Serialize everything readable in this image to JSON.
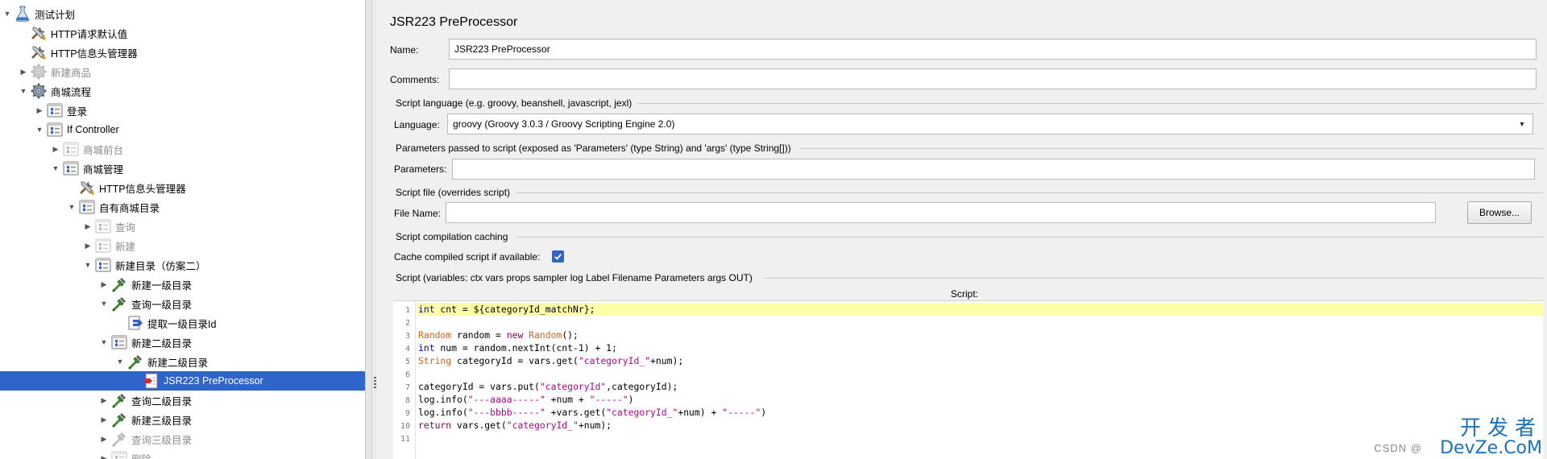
{
  "tree": {
    "items": [
      {
        "label": "测试计划",
        "icon": "flask-icon",
        "level": 0,
        "expander": "down",
        "disabled": false,
        "selected": false
      },
      {
        "label": "HTTP请求默认值",
        "icon": "tools-icon",
        "level": 1,
        "expander": "none",
        "disabled": false,
        "selected": false
      },
      {
        "label": "HTTP信息头管理器",
        "icon": "tools-icon",
        "level": 1,
        "expander": "none",
        "disabled": false,
        "selected": false
      },
      {
        "label": "新建商品",
        "icon": "gear-icon",
        "level": 1,
        "expander": "right",
        "disabled": true,
        "selected": false
      },
      {
        "label": "商城流程",
        "icon": "gear-icon",
        "level": 1,
        "expander": "down",
        "disabled": false,
        "selected": false
      },
      {
        "label": "登录",
        "icon": "controller-icon",
        "level": 2,
        "expander": "right",
        "disabled": false,
        "selected": false
      },
      {
        "label": "If Controller",
        "icon": "controller-icon",
        "level": 2,
        "expander": "down",
        "disabled": false,
        "selected": false
      },
      {
        "label": "商城前台",
        "icon": "controller-icon",
        "level": 3,
        "expander": "right",
        "disabled": true,
        "selected": false
      },
      {
        "label": "商城管理",
        "icon": "controller-icon",
        "level": 3,
        "expander": "down",
        "disabled": false,
        "selected": false
      },
      {
        "label": "HTTP信息头管理器",
        "icon": "tools-icon",
        "level": 4,
        "expander": "none",
        "disabled": false,
        "selected": false
      },
      {
        "label": "自有商城目录",
        "icon": "controller-icon",
        "level": 4,
        "expander": "down",
        "disabled": false,
        "selected": false
      },
      {
        "label": "查询",
        "icon": "controller-icon",
        "level": 5,
        "expander": "right",
        "disabled": true,
        "selected": false
      },
      {
        "label": "新建",
        "icon": "controller-icon",
        "level": 5,
        "expander": "right",
        "disabled": true,
        "selected": false
      },
      {
        "label": "新建目录（仿案二）",
        "icon": "controller-icon",
        "level": 5,
        "expander": "down",
        "disabled": false,
        "selected": false
      },
      {
        "label": "新建一级目录",
        "icon": "sampler-icon",
        "level": 6,
        "expander": "right",
        "disabled": false,
        "selected": false
      },
      {
        "label": "查询一级目录",
        "icon": "sampler-icon",
        "level": 6,
        "expander": "down",
        "disabled": false,
        "selected": false
      },
      {
        "label": "提取一级目录Id",
        "icon": "extractor-icon",
        "level": 7,
        "expander": "none",
        "disabled": false,
        "selected": false
      },
      {
        "label": "新建二级目录",
        "icon": "controller-icon",
        "level": 6,
        "expander": "down",
        "disabled": false,
        "selected": false
      },
      {
        "label": "新建二级目录",
        "icon": "sampler-icon",
        "level": 7,
        "expander": "down",
        "disabled": false,
        "selected": false
      },
      {
        "label": "JSR223 PreProcessor",
        "icon": "script-icon",
        "level": 8,
        "expander": "none",
        "disabled": false,
        "selected": true
      },
      {
        "label": "查询二级目录",
        "icon": "sampler-icon",
        "level": 6,
        "expander": "right",
        "disabled": false,
        "selected": false
      },
      {
        "label": "新建三级目录",
        "icon": "sampler-icon",
        "level": 6,
        "expander": "right",
        "disabled": false,
        "selected": false
      },
      {
        "label": "查询三级目录",
        "icon": "sampler-icon",
        "level": 6,
        "expander": "right",
        "disabled": true,
        "selected": false
      },
      {
        "label": "删除",
        "icon": "controller-icon",
        "level": 6,
        "expander": "right",
        "disabled": true,
        "selected": false
      }
    ]
  },
  "editor": {
    "title": "JSR223 PreProcessor",
    "name_label": "Name:",
    "name_value": "JSR223 PreProcessor",
    "comments_label": "Comments:",
    "comments_value": "",
    "script_language_section": "Script language (e.g. groovy, beanshell, javascript, jexl)",
    "language_label": "Language:",
    "language_value": "groovy     (Groovy 3.0.3 / Groovy Scripting Engine 2.0)",
    "parameters_section": "Parameters passed to script (exposed as 'Parameters' (type String) and 'args' (type String[]))",
    "parameters_label": "Parameters:",
    "parameters_value": "",
    "script_file_section": "Script file (overrides script)",
    "file_name_label": "File Name:",
    "file_name_value": "",
    "browse_label": "Browse...",
    "caching_section": "Script compilation caching",
    "cache_label": "Cache compiled script if available:",
    "cache_checked": true,
    "script_section": "Script (variables: ctx vars props sampler log Label Filename Parameters args OUT)",
    "script_header": "Script:",
    "code_lines": [
      "int cnt = ${categoryId_matchNr};",
      "",
      "Random random = new Random();",
      "int num = random.nextInt(cnt-1) + 1;",
      "String categoryId = vars.get(\"categoryId_\"+num);",
      "",
      "categoryId = vars.put(\"categoryId\",categoryId);",
      "log.info(\"---aaaa-----\" +num + \"-----\")",
      "log.info(\"---bbbb-----\" +vars.get(\"categoryId_\"+num) + \"-----\")",
      "return vars.get(\"categoryId_\"+num);",
      ""
    ],
    "current_line": 1
  },
  "watermark": {
    "cn": "开发者",
    "en": "DevZe.CoM",
    "csdn": "CSDN @"
  },
  "colors": {
    "selection": "#2f65ca",
    "current_line": "#ffffaa",
    "keyword": "#7f0055",
    "type": "#c8641e",
    "string": "#b4008c",
    "watermark": "#1a73b8"
  }
}
